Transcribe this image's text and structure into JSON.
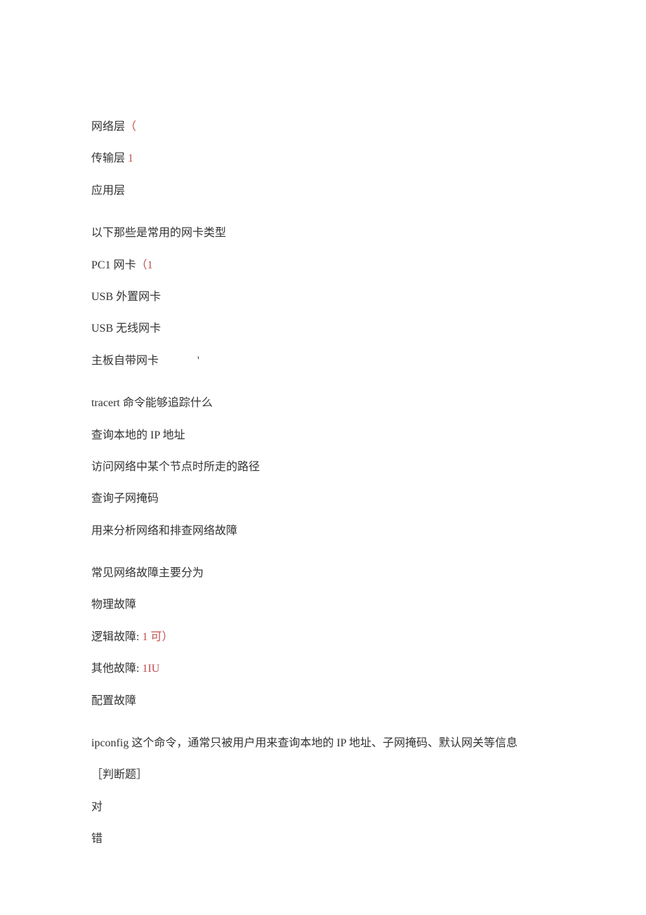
{
  "lines": {
    "l1_pre": "网络层",
    "l1_red": "（",
    "l2_pre": "传输层",
    "l2_red": " 1",
    "l3": "应用层",
    "q2": "以下那些是常用的网卡类型",
    "q2_a_pre": "PC1 网卡",
    "q2_a_red": "（1",
    "q2_b": "USB 外置网卡",
    "q2_c": "USB 无线网卡",
    "q2_d": "主板自带网卡",
    "q2_d_apos": "'",
    "q3": "tracert 命令能够追踪什么",
    "q3_a": "查询本地的 IP 地址",
    "q3_b": "访问网络中某个节点时所走的路径",
    "q3_c": "查询子网掩码",
    "q3_d": "用来分析网络和排查网络故障",
    "q4": "常见网络故障主要分为",
    "q4_a": "物理故障",
    "q4_b_pre": "逻辑故障:",
    "q4_b_red": " 1 可）",
    "q4_c_pre": "其他故障:",
    "q4_c_red": " 1IU",
    "q4_d": "配置故障",
    "q5": "ipconfig 这个命令，通常只被用户用来查询本地的 IP 地址、子网掩码、默认网关等信息",
    "q5_tag": "［判断题］",
    "q5_a": "对",
    "q5_b": "错"
  }
}
